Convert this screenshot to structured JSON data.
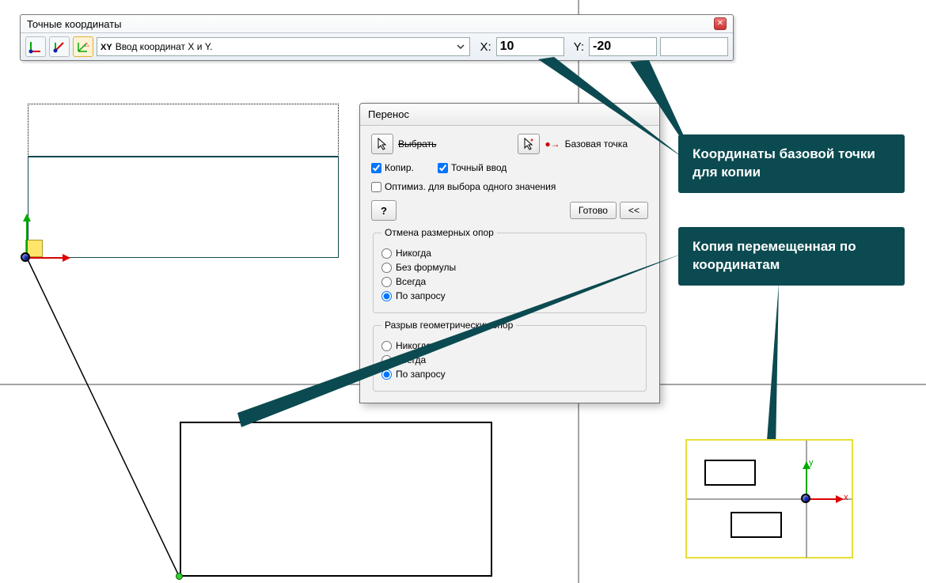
{
  "toolbar": {
    "title": "Точные координаты",
    "dropdown_prefix": "XY",
    "dropdown_label": "Ввод координат X и Y.",
    "x_label": "X:",
    "y_label": "Y:",
    "x_value": "10",
    "y_value": "-20"
  },
  "dialog": {
    "title": "Перенос",
    "select_label": "Выбрать",
    "base_point_label": "Базовая точка",
    "copy_label": "Копир.",
    "precise_label": "Точный ввод",
    "optimize_label": "Оптимиз. для выбора одного значения",
    "done_label": "Готово",
    "back_label": "<<",
    "group1_title": "Отмена размерных опор",
    "group1_options": [
      "Никогда",
      "Без формулы",
      "Всегда",
      "По запросу"
    ],
    "group1_selected": 3,
    "group2_title": "Разрыв геометрических опор",
    "group2_options": [
      "Никогда",
      "Всегда",
      "По запросу"
    ],
    "group2_selected": 2
  },
  "callouts": {
    "c1": "Координаты базовой точки для копии",
    "c2": "Копия перемещенная по координатам"
  },
  "icons": {
    "close": "✕",
    "help": "?",
    "cursor": "cursor",
    "cursor_star": "cursor-star",
    "coord_mode_1": "coord-mode-abs",
    "coord_mode_2": "coord-mode-rel",
    "coord_mode_3": "coord-mode-polar",
    "base_point_glyph": "●→",
    "x_axis_label": "x",
    "y_axis_label": "y"
  }
}
